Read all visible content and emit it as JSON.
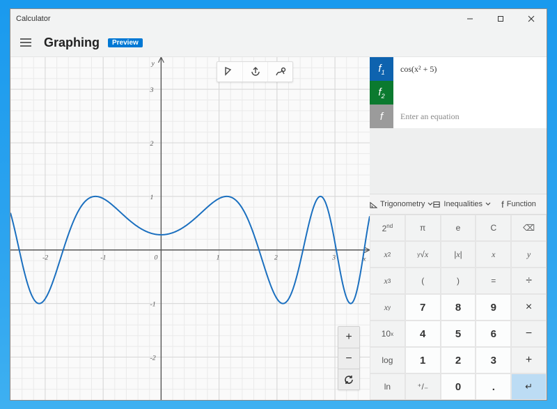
{
  "window": {
    "title": "Calculator"
  },
  "header": {
    "mode": "Graphing",
    "badge": "Preview"
  },
  "equations": {
    "f1": {
      "label": "f",
      "sub": "1",
      "expr": "cos(x² + 5)",
      "color": "#0e63af"
    },
    "f2": {
      "label": "f",
      "sub": "2",
      "expr": "",
      "color": "#0b7a2f"
    },
    "new": {
      "label": "f",
      "placeholder": "Enter an equation"
    }
  },
  "categories": {
    "trig": "Trigonometry",
    "ineq": "Inequalities",
    "func": "Function"
  },
  "keys": {
    "second": "2ⁿᵈ",
    "pi": "π",
    "e": "e",
    "clear": "C",
    "back": "⌫",
    "xsq": "x²",
    "yroot": "ʸ√x",
    "abs": "|x|",
    "xvar": "x",
    "yvar": "y",
    "xcube": "x³",
    "lparen": "(",
    "rparen": ")",
    "equals": "=",
    "div": "÷",
    "xy": "xʸ",
    "k7": "7",
    "k8": "8",
    "k9": "9",
    "mul": "×",
    "tenx": "10ˣ",
    "k4": "4",
    "k5": "5",
    "k6": "6",
    "sub": "−",
    "log": "log",
    "k1": "1",
    "k2": "2",
    "k3": "3",
    "add": "+",
    "ln": "ln",
    "negate": "⁺/₋",
    "k0": "0",
    "dot": ".",
    "enter": "↵"
  },
  "chart_data": {
    "type": "line",
    "title": "",
    "xlabel": "x",
    "ylabel": "y",
    "xlim": [
      -2.6,
      3.6
    ],
    "ylim": [
      -2.8,
      3.6
    ],
    "xticks": [
      -2,
      -1,
      0,
      1,
      2,
      3
    ],
    "yticks": [
      -2,
      -1,
      1,
      2,
      3
    ],
    "grid": true,
    "series": [
      {
        "name": "cos(x² + 5)",
        "color": "#1a6fbf",
        "formula": "cos(x*x + 5)"
      }
    ]
  }
}
